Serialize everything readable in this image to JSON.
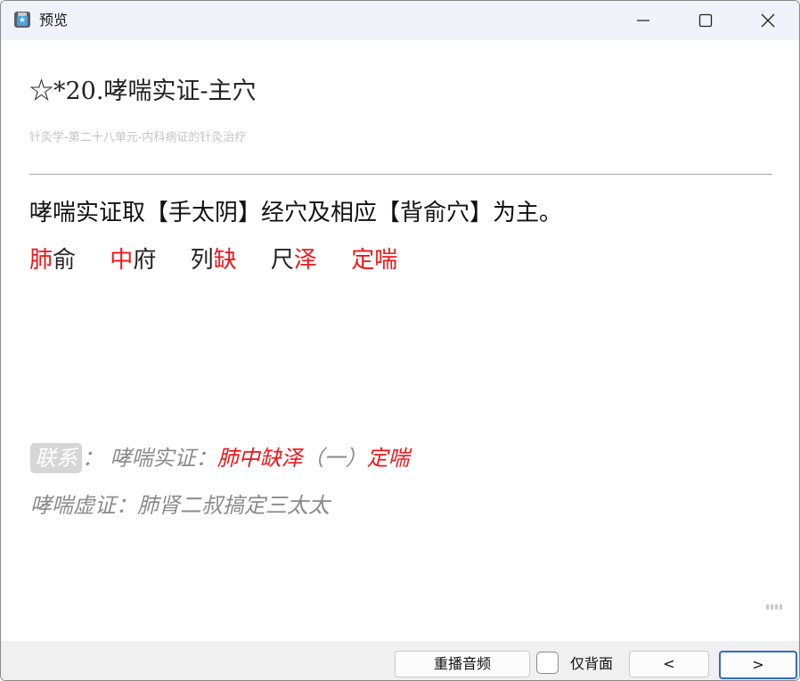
{
  "window": {
    "title": "预览",
    "app_icon": "star-card-icon",
    "controls": [
      "minimize-icon",
      "maximize-icon",
      "close-icon"
    ]
  },
  "card": {
    "title": "☆*20.哮喘实证-主穴",
    "subtitle": "针灸学-第二十八单元-内科病证的针灸治疗",
    "main_text": "哮喘实证取【手太阴】经穴及相应【背俞穴】为主。",
    "points": [
      {
        "red": "肺",
        "rest": "俞",
        "red_first": true
      },
      {
        "red": "中",
        "rest": "府",
        "red_first": true
      },
      {
        "pre": "列",
        "red": "缺",
        "red_first": false
      },
      {
        "pre": "尺",
        "red": "泽",
        "red_first": false
      },
      {
        "red": "定喘",
        "rest": "",
        "red_first": true
      }
    ],
    "mnemonic": {
      "tag": "联系",
      "sep": "：",
      "label": "哮喘实证：",
      "phrase_red_1": "肺中缺泽",
      "phrase_grey": "（一）",
      "phrase_red_2": "定喘"
    },
    "mnemonic2": "哮喘虚证：肺肾二叔搞定三太太"
  },
  "bottom_bar": {
    "replay_label": "重播音频",
    "back_only_label": "仅背面",
    "back_only_checked": false,
    "prev_label": "<",
    "next_label": ">"
  },
  "colors": {
    "accent_red": "#f0151a",
    "focus_blue": "#2f6ec4",
    "muted_grey": "#8a8a8a"
  }
}
